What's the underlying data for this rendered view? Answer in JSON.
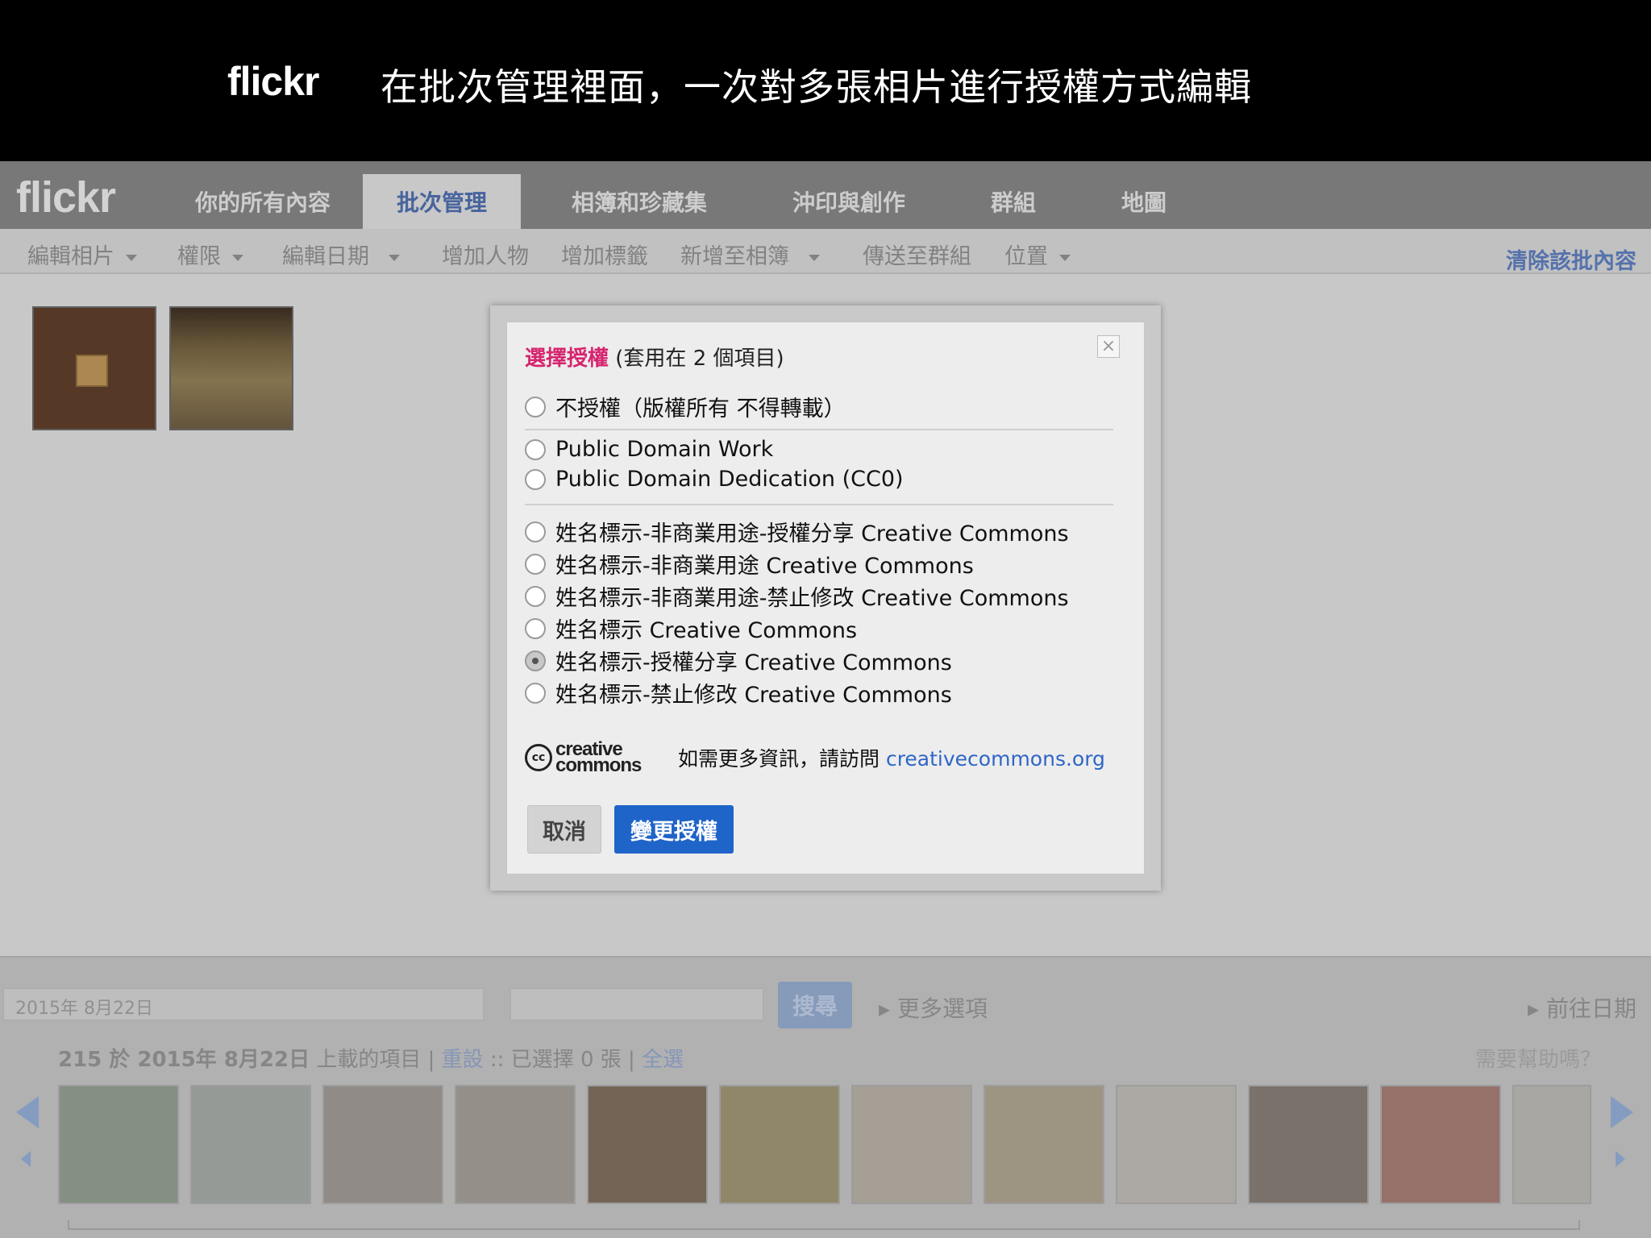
{
  "slide": {
    "logo": "flickr",
    "title": "在批次管理裡面，一次對多張相片進行授權方式編輯"
  },
  "app": {
    "logo": "flickr",
    "tabs": [
      {
        "label": "你的所有內容",
        "active": false
      },
      {
        "label": "批次管理",
        "active": true
      },
      {
        "label": "相簿和珍藏集",
        "active": false
      },
      {
        "label": "沖印與創作",
        "active": false
      },
      {
        "label": "群組",
        "active": false
      },
      {
        "label": "地圖",
        "active": false
      }
    ],
    "subnav": {
      "edit_photos": "編輯相片",
      "permissions": "權限",
      "edit_date": "編輯日期",
      "add_people": "增加人物",
      "add_tags": "增加標籤",
      "add_to_album": "新增至相簿",
      "send_to_group": "傳送至群組",
      "location": "位置",
      "clear_batch": "清除該批內容"
    }
  },
  "dialog": {
    "title_highlight": "選擇授權",
    "title_rest": " (套用在 2 個項目)",
    "close_label": "×",
    "options": [
      {
        "label": "不授權（版權所有 不得轉載）",
        "checked": false
      },
      {
        "label": "Public Domain Work",
        "checked": false
      },
      {
        "label": "Public Domain Dedication (CC0)",
        "checked": false
      },
      {
        "label": "姓名標示-非商業用途-授權分享 Creative Commons",
        "checked": false
      },
      {
        "label": "姓名標示-非商業用途 Creative Commons",
        "checked": false
      },
      {
        "label": "姓名標示-非商業用途-禁止修改 Creative Commons",
        "checked": false
      },
      {
        "label": "姓名標示 Creative Commons",
        "checked": false
      },
      {
        "label": "姓名標示-授權分享 Creative Commons",
        "checked": true
      },
      {
        "label": "姓名標示-禁止修改 Creative Commons",
        "checked": false
      }
    ],
    "cc_logo_mark": "cc",
    "cc_logo_line1": "creative",
    "cc_logo_line2": "commons",
    "info_text": "如需更多資訊，請訪問 ",
    "info_link": "creativecommons.org",
    "cancel_label": "取消",
    "apply_label": "變更授權"
  },
  "tray": {
    "date_value": "2015年 8月22日",
    "search_button": "搜尋",
    "more_options": "更多選項",
    "prev_date": "前往日期",
    "status_count": "215 於 2015年 8月22日",
    "status_uploaded": " 上載的項目 | ",
    "status_reset": "重設",
    "status_selected": " :: 已選擇 0 張 | ",
    "status_select_all": "全選",
    "help": "需要幫助嗎？"
  },
  "colors": {
    "accent_pink": "#d6246e",
    "button_blue": "#1f64c8",
    "link_blue": "#2f66c7"
  }
}
